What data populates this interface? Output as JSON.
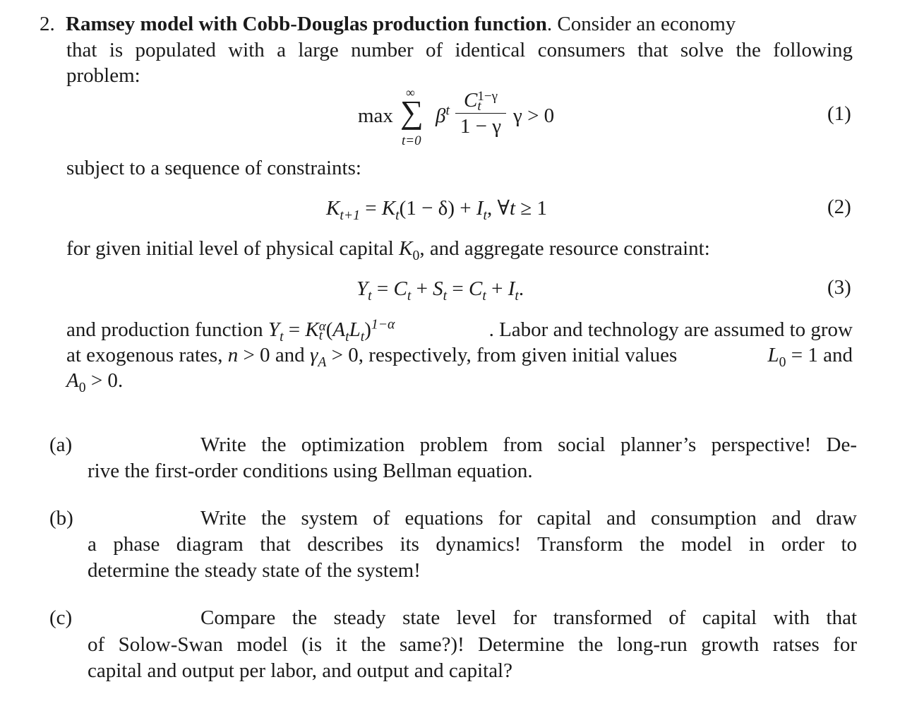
{
  "problem": {
    "number": "2.",
    "title": "Ramsey model with Cobb-Douglas production function",
    "intro_line1_rest": ". Consider an economy",
    "intro_line2": "that is populated with a large number of identical consumers that solve the following",
    "intro_line3": "problem:",
    "subject_to": "subject to a sequence of constraints:",
    "for_given_pre": "for given initial level of physical capital ",
    "for_given_post": ", and aggregate resource constraint:",
    "prod_pre": "and production function ",
    "prod_post": ". Labor and technology are assumed to grow",
    "rates_pre": "at exogenous rates, ",
    "rates_and": " and ",
    "rates_mid": ", respectively, from given initial values ",
    "rates_end": " and",
    "a0_line_end": "."
  },
  "equations": {
    "eq1": {
      "max": "max",
      "sum_upper": "∞",
      "sum_lower": "t=0",
      "beta": "β",
      "beta_sup": "t",
      "num_base": "C",
      "num_sub": "t",
      "num_sup": "1−γ",
      "denominator": "1 − γ",
      "condition": "γ > 0",
      "number": "(1)"
    },
    "eq2": {
      "text_parts": [
        "K",
        "t+1",
        " = ",
        "K",
        "t",
        "(1 − δ) + ",
        "I",
        "t",
        ", ∀",
        "t",
        " ≥ 1"
      ],
      "number": "(2)"
    },
    "eq3": {
      "text_parts": [
        "Y",
        "t",
        " = ",
        "C",
        "t",
        " + ",
        "S",
        "t",
        " = ",
        "C",
        "t",
        " + ",
        "I",
        "t",
        "."
      ],
      "number": "(3)"
    },
    "inline": {
      "K0": "K",
      "K0_sub": "0",
      "Yt": "Y",
      "Yt_sub": "t",
      "eq": " = ",
      "Kt": "K",
      "Kt_sup": "α",
      "Kt_sub": "t",
      "AtLt_open": "(",
      "At": "A",
      "At_sub": "t",
      "Lt": "L",
      "Lt_sub": "t",
      "AtLt_close": ")",
      "exp": "1−α",
      "n": "n",
      "gt0": " > 0",
      "gammaA": "γ",
      "gammaA_sub": "A",
      "L0": "L",
      "L0_sub": "0",
      "L0_val": " = 1",
      "A0": "A",
      "A0_sub": "0"
    }
  },
  "parts": [
    {
      "label": "(a)",
      "line1": "Write the optimization problem from social planner’s perspective! De-",
      "line2": "rive the first-order conditions using Bellman equation."
    },
    {
      "label": "(b)",
      "line1": "Write the system of equations for capital and consumption and draw",
      "line2": "a phase diagram that describes its dynamics!  Transform the model in order to",
      "line3": "determine the steady state of the system!"
    },
    {
      "label": "(c)",
      "line1": "Compare the steady state level for transformed of capital with that",
      "line2": "of Solow-Swan model (is it the same?)! Determine the long-run growth ratses for",
      "line3": "capital and output per labor, and output and capital?"
    }
  ]
}
